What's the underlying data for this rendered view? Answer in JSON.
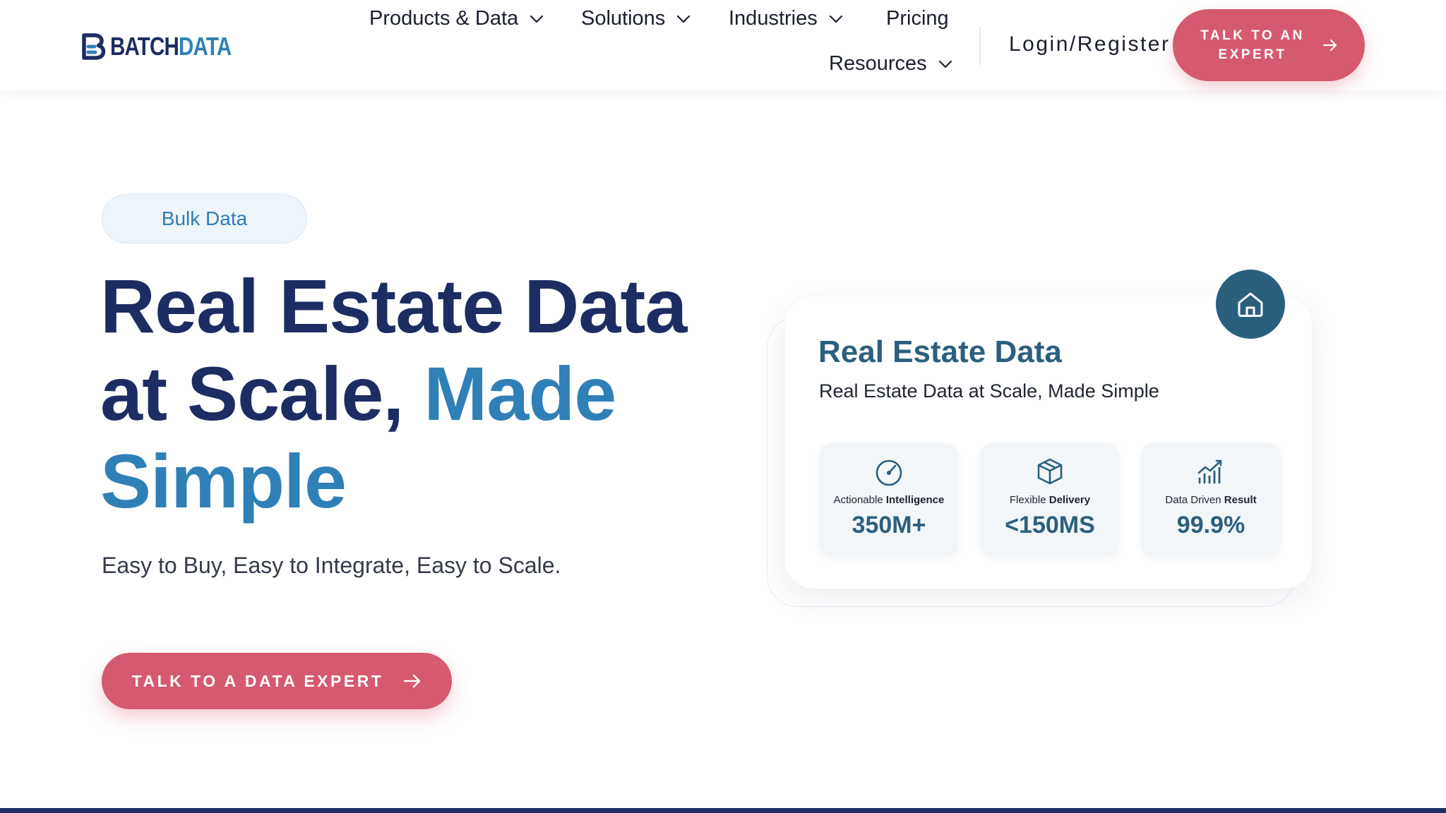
{
  "header": {
    "logo": {
      "part1": "BATCH",
      "part2": "DATA"
    },
    "nav": [
      {
        "label": "Products & Data",
        "has_dropdown": true
      },
      {
        "label": "Solutions",
        "has_dropdown": true
      },
      {
        "label": "Industries",
        "has_dropdown": true
      },
      {
        "label": "Pricing",
        "has_dropdown": false
      },
      {
        "label": "Resources",
        "has_dropdown": true
      }
    ],
    "login_label": "Login/Register",
    "cta_label": "TALK TO AN EXPERT"
  },
  "hero": {
    "badge": "Bulk Data",
    "title_line1": "Real Estate Data",
    "title_line2": "at Scale,",
    "title_accent_1": "Made",
    "title_accent_2": "Simple",
    "subtitle": "Easy to Buy, Easy to Integrate, Easy to Scale.",
    "cta_label": "TALK TO A DATA EXPERT"
  },
  "card": {
    "title": "Real Estate Data",
    "subtitle": "Real Estate Data at Scale, Made Simple",
    "stats": [
      {
        "icon": "gauge-icon",
        "label_plain": "Actionable",
        "label_bold": "Intelligence",
        "value": "350M+"
      },
      {
        "icon": "box-icon",
        "label_plain": "Flexible",
        "label_bold": "Delivery",
        "value": "<150MS"
      },
      {
        "icon": "chart-trend-icon",
        "label_plain": "Data Driven",
        "label_bold": "Result",
        "value": "99.9%"
      }
    ]
  },
  "colors": {
    "navy": "#1d2d63",
    "accent_blue": "#2f80b7",
    "cta_pink": "#d55a6f",
    "card_teal": "#2b5f7e"
  }
}
